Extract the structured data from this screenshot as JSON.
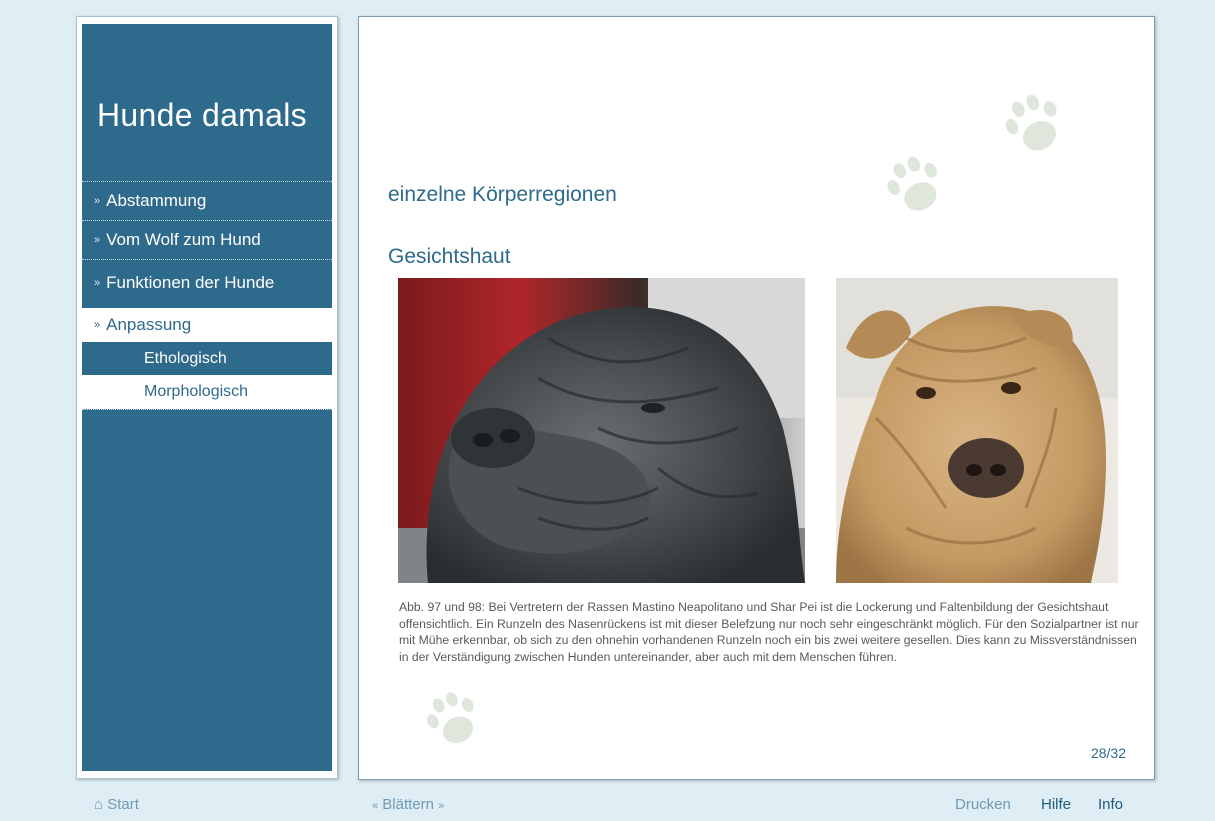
{
  "sidebar": {
    "title": "Hunde damals",
    "nav": [
      {
        "label": "Abstammung"
      },
      {
        "label": "Vom Wolf zum Hund"
      },
      {
        "label": "Funktionen der Hunde"
      },
      {
        "label": "Anpassung",
        "active": true
      }
    ],
    "subnav": [
      {
        "label": "Ethologisch"
      },
      {
        "label": "Morphologisch",
        "active": true
      }
    ]
  },
  "content": {
    "subtitle": "einzelne Körperregionen",
    "heading": "Gesichtshaut",
    "caption": "Abb. 97 und 98: Bei Vertretern der Rassen Mastino Neapolitano und Shar Pei ist die Lockerung und Faltenbildung der Gesichtshaut offensichtlich. Ein Runzeln des Nasenrückens ist mit dieser Belefzung nur noch sehr eingeschränkt möglich. Für den Sozialpartner ist nur mit Mühe erkennbar, ob sich zu den ohnehin vorhandenen Runzeln noch ein bis zwei weitere gesellen. Dies kann zu Missverständnissen in der Verständigung zwischen Hunden untereinander, aber auch mit dem Menschen führen.",
    "page": "28/32",
    "images": [
      {
        "icon": "mastino-photo"
      },
      {
        "icon": "shar-pei-photo"
      }
    ]
  },
  "footer": {
    "start": "Start",
    "blaettern": "Blättern",
    "drucken": "Drucken",
    "hilfe": "Hilfe",
    "info": "Info"
  },
  "colors": {
    "background": "#dfedf5",
    "sidebar": "#2e6a8c",
    "accent": "#2e6a8c",
    "paw": "#dfe6dc"
  }
}
